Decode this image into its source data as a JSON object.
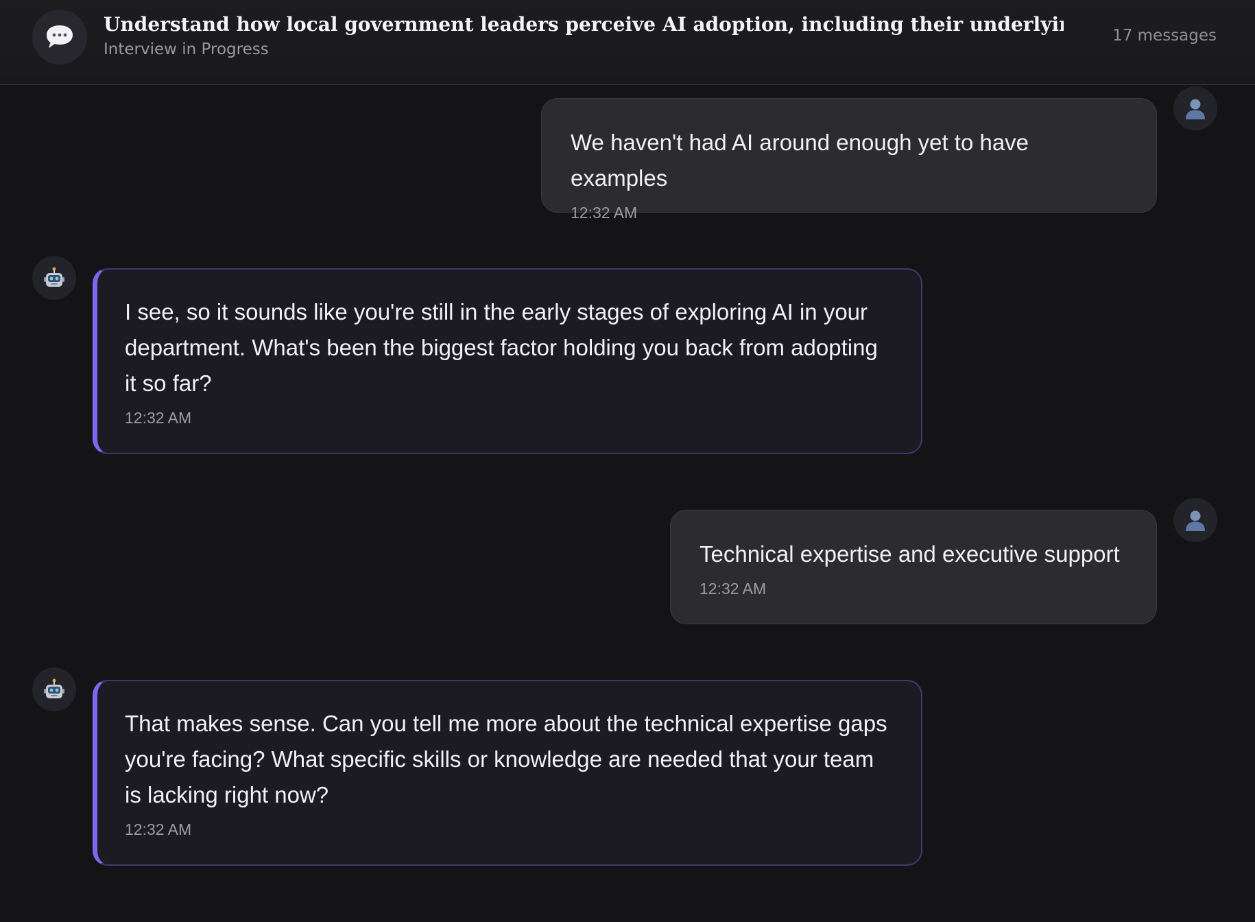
{
  "header": {
    "title": "Understand how local government leaders perceive AI adoption, including their underlying concerns...",
    "subtitle": "Interview in Progress",
    "message_count": "17 messages",
    "icon": "speech-bubble-icon"
  },
  "messages": [
    {
      "role": "user",
      "avatar_icon": "user-silhouette-icon",
      "text": "We haven't had AI around enough yet to have examples",
      "time": "12:32 AM"
    },
    {
      "role": "assistant",
      "avatar_icon": "robot-icon",
      "text": "I see, so it sounds like you're still in the early stages of exploring AI in your department. What's been the biggest factor holding you back from adopting it so far?",
      "time": "12:32 AM"
    },
    {
      "role": "user",
      "avatar_icon": "user-silhouette-icon",
      "text": "Technical expertise and executive support",
      "time": "12:32 AM"
    },
    {
      "role": "assistant",
      "avatar_icon": "robot-icon",
      "text": "That makes sense. Can you tell me more about the technical expertise gaps you're facing? What specific skills or knowledge are needed that your team is lacking right now?",
      "time": "12:32 AM"
    }
  ]
}
